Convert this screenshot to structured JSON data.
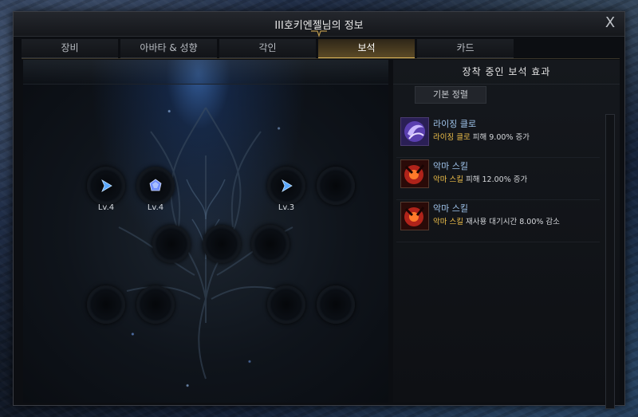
{
  "window": {
    "title": "III호키엔젤님의 정보",
    "close_label": "X"
  },
  "tabs": [
    {
      "label": "장비",
      "active": false
    },
    {
      "label": "아바타 & 성향",
      "active": false
    },
    {
      "label": "각인",
      "active": false
    },
    {
      "label": "보석",
      "active": true
    },
    {
      "label": "카드",
      "active": false
    }
  ],
  "gem_sockets": [
    {
      "filled": true,
      "gem": "blue-gem-icon",
      "level": "Lv.4"
    },
    {
      "filled": true,
      "gem": "crystal-gem-icon",
      "level": "Lv.4"
    },
    {
      "filled": true,
      "gem": "blue-gem-icon",
      "level": "Lv.3"
    },
    {
      "filled": false
    },
    {
      "filled": false
    },
    {
      "filled": false
    },
    {
      "filled": false
    },
    {
      "filled": false
    },
    {
      "filled": false
    },
    {
      "filled": false
    },
    {
      "filled": false
    }
  ],
  "effects_panel": {
    "title": "장착 중인 보석 효과",
    "sort_label": "기본 정렬",
    "effects": [
      {
        "icon": "rising-claw-icon",
        "name": "라이징 클로",
        "skill": "라이징 클로",
        "desc": " 피해 9.00% 증가"
      },
      {
        "icon": "demon-skill-icon",
        "name": "악마 스킬",
        "skill": "악마 스킬",
        "desc": " 피해 12.00% 증가"
      },
      {
        "icon": "demon-skill-icon",
        "name": "악마 스킬",
        "skill": "악마 스킬",
        "desc": " 재사용 대기시간 8.00% 감소"
      }
    ]
  },
  "colors": {
    "active_tab_accent": "#d9b45a",
    "skill_name": "#9fc3ea",
    "skill_highlight": "#f0c04a"
  }
}
